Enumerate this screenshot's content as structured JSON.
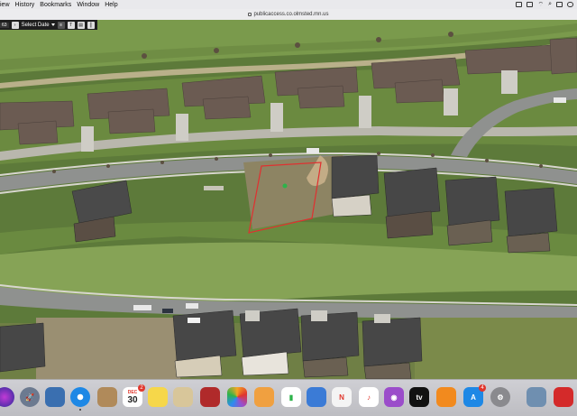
{
  "menubar": {
    "items": [
      "View",
      "History",
      "Bookmarks",
      "Window",
      "Help"
    ],
    "visible_items": [
      "iew",
      "History",
      "Bookmarks",
      "Window",
      "Help"
    ]
  },
  "browser": {
    "url": "publicaccess.co.olmsted.mn.us"
  },
  "app_toolbar": {
    "number": "63",
    "select_date_label": "Select Date"
  },
  "map": {
    "selection_color": "#e03030",
    "marker_color": "#2db34a"
  },
  "dock": {
    "calendar_month": "DEC",
    "calendar_day": "30",
    "calendar_badge": "2",
    "appstore_badge": "4",
    "icons": [
      "siri-icon",
      "launchpad-icon",
      "preview-icon",
      "safari-icon",
      "notes-icon",
      "calendar-icon",
      "stickies-icon",
      "files-icon",
      "photo-booth-icon",
      "photos-icon",
      "keynote-icon",
      "numbers-icon",
      "pages-icon",
      "news-icon",
      "music-icon",
      "podcasts-icon",
      "apple-tv-icon",
      "books-icon",
      "app-store-icon",
      "system-preferences-icon",
      "preview-viewer-icon",
      "acrobat-icon"
    ]
  }
}
